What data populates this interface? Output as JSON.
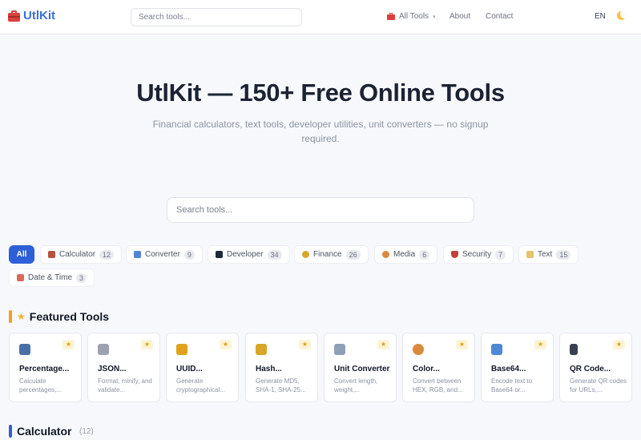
{
  "header": {
    "logo_text": "UtlKit",
    "search_placeholder": "Search tools...",
    "nav_all_tools": "All Tools",
    "nav_about": "About",
    "nav_contact": "Contact",
    "lang": "EN"
  },
  "hero": {
    "title": "UtlKit — 150+ Free Online Tools",
    "subtitle": "Financial calculators, text tools, developer utilities, unit converters — no signup required.",
    "search_placeholder": "Search tools..."
  },
  "categories": [
    {
      "label": "All",
      "count": ""
    },
    {
      "label": "Calculator",
      "count": "12"
    },
    {
      "label": "Converter",
      "count": "9"
    },
    {
      "label": "Developer",
      "count": "34"
    },
    {
      "label": "Finance",
      "count": "26"
    },
    {
      "label": "Media",
      "count": "6"
    },
    {
      "label": "Security",
      "count": "7"
    },
    {
      "label": "Text",
      "count": "15"
    },
    {
      "label": "Date & Time",
      "count": "3"
    }
  ],
  "featured": {
    "title": "Featured Tools",
    "cards": [
      {
        "title": "Percentage...",
        "desc": "Calculate percentages,...",
        "icon": "calculator-icon",
        "color": "#4a6fa5"
      },
      {
        "title": "JSON...",
        "desc": "Format, minify, and validate...",
        "icon": "clipboard-icon",
        "color": "#9ca3af"
      },
      {
        "title": "UUID...",
        "desc": "Generate cryptographical...",
        "icon": "key-icon",
        "color": "#e0a21b"
      },
      {
        "title": "Hash...",
        "desc": "Generate MD5, SHA-1, SHA-25...",
        "icon": "lock-icon",
        "color": "#d9a62a"
      },
      {
        "title": "Unit Converter",
        "desc": "Convert length, weight,...",
        "icon": "ruler-icon",
        "color": "#8ea0b8"
      },
      {
        "title": "Color...",
        "desc": "Convert between HEX, RGB, and...",
        "icon": "palette-icon",
        "color": "#d98a3d"
      },
      {
        "title": "Base64...",
        "desc": "Encode text to Base64 or...",
        "icon": "refresh-icon",
        "color": "#4f86d6"
      },
      {
        "title": "QR Code...",
        "desc": "Generate QR codes for URLs,...",
        "icon": "phone-icon",
        "color": "#374151"
      }
    ]
  },
  "calculator_section": {
    "title": "Calculator",
    "count": "(12)"
  },
  "colors": {
    "accent": "#2f5fd8",
    "featured_bar": "#f0a020",
    "calculator_bar": "#2f5fd8"
  }
}
